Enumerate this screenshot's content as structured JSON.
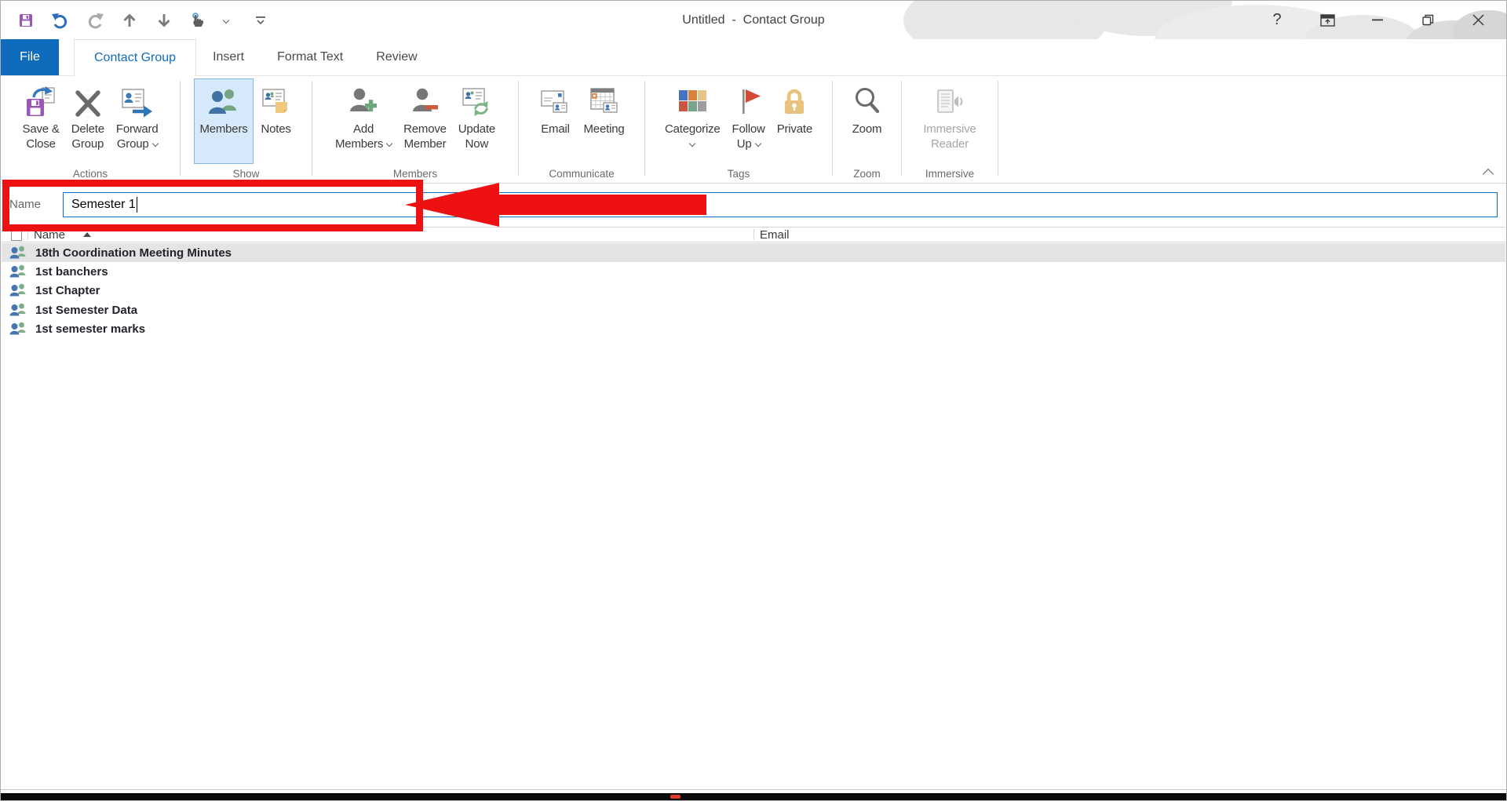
{
  "colors": {
    "accent_blue": "#0F6CBD",
    "annotation_red": "#EE1111",
    "members_highlight_bg": "#D5E9FA",
    "selected_row_bg": "#E4E4E4"
  },
  "titlebar": {
    "title": "Untitled  -  Contact Group",
    "help_label": "?"
  },
  "tabs": {
    "file": "File",
    "contact_group": "Contact Group",
    "insert": "Insert",
    "format_text": "Format Text",
    "review": "Review"
  },
  "ribbon": {
    "groups": [
      {
        "label": "Actions",
        "buttons": [
          {
            "line1": "Save &",
            "line2": "Close",
            "icon": "save-close-icon"
          },
          {
            "line1": "Delete",
            "line2": "Group",
            "icon": "delete-group-icon"
          },
          {
            "line1": "Forward",
            "line2": "Group",
            "chevron": true,
            "icon": "forward-group-icon"
          }
        ]
      },
      {
        "label": "Show",
        "buttons": [
          {
            "line1": "Members",
            "selected": true,
            "icon": "members-icon"
          },
          {
            "line1": "Notes",
            "icon": "notes-icon"
          }
        ]
      },
      {
        "label": "Members",
        "buttons": [
          {
            "line1": "Add",
            "line2": "Members",
            "chevron": true,
            "icon": "add-members-icon"
          },
          {
            "line1": "Remove",
            "line2": "Member",
            "icon": "remove-member-icon"
          },
          {
            "line1": "Update",
            "line2": "Now",
            "icon": "update-now-icon"
          }
        ]
      },
      {
        "label": "Communicate",
        "buttons": [
          {
            "line1": "Email",
            "icon": "email-icon"
          },
          {
            "line1": "Meeting",
            "icon": "meeting-icon"
          }
        ]
      },
      {
        "label": "Tags",
        "buttons": [
          {
            "line1": "Categorize",
            "line2": "",
            "chevron": true,
            "icon": "categorize-icon"
          },
          {
            "line1": "Follow",
            "line2": "Up",
            "chevron": true,
            "icon": "follow-up-icon"
          },
          {
            "line1": "Private",
            "icon": "private-icon"
          }
        ]
      },
      {
        "label": "Zoom",
        "buttons": [
          {
            "line1": "Zoom",
            "icon": "zoom-icon"
          }
        ]
      },
      {
        "label": "Immersive",
        "buttons": [
          {
            "line1": "Immersive",
            "line2": "Reader",
            "disabled": true,
            "icon": "immersive-reader-icon"
          }
        ]
      }
    ]
  },
  "form": {
    "name_label": "Name",
    "name_value": "Semester 1"
  },
  "members_table": {
    "name_header": "Name",
    "email_header": "Email",
    "sort": "ascending",
    "rows": [
      {
        "name": "18th Coordination Meeting Minutes",
        "email": "",
        "selected": true
      },
      {
        "name": "1st banchers",
        "email": ""
      },
      {
        "name": "1st Chapter",
        "email": ""
      },
      {
        "name": "1st Semester Data",
        "email": ""
      },
      {
        "name": "1st semester marks",
        "email": ""
      }
    ]
  }
}
